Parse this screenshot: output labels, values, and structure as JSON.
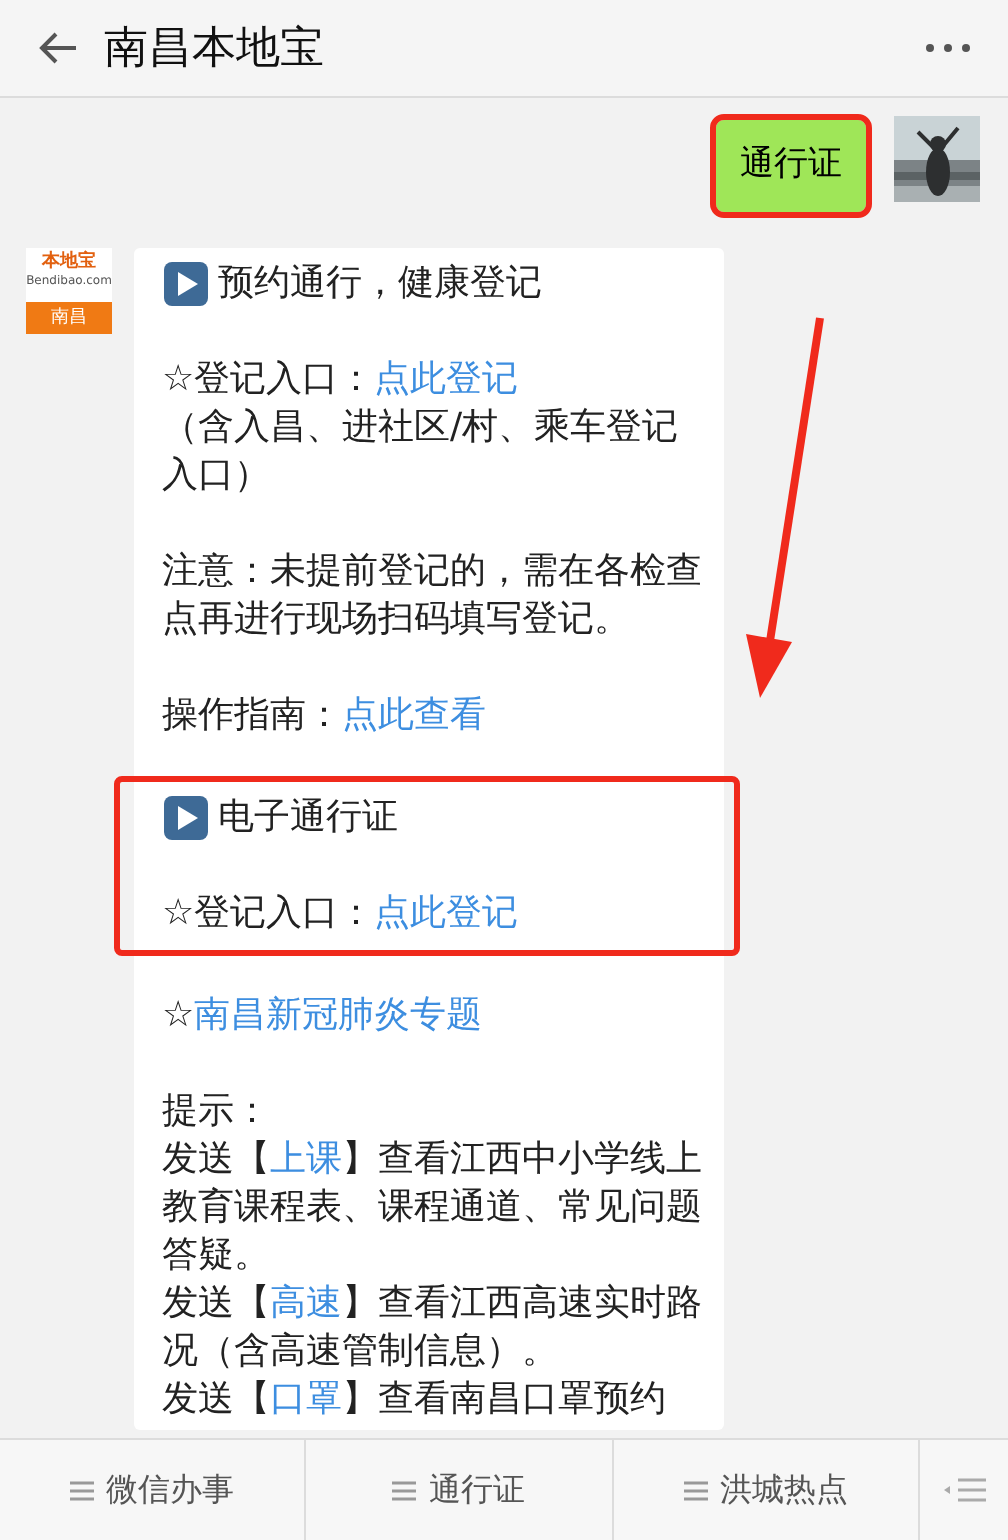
{
  "header": {
    "title": "南昌本地宝"
  },
  "user_message": {
    "text": "通行证",
    "highlighted": true
  },
  "bot": {
    "avatar_brand": "本地宝",
    "avatar_domain": "Bendibao.com",
    "avatar_city": "南昌"
  },
  "blocks": [
    {
      "highlighted": false,
      "lines": [
        {
          "kind": "heading",
          "text": "预约通行，健康登记"
        }
      ]
    },
    {
      "highlighted": false,
      "lines": [
        {
          "kind": "field",
          "label": "☆登记入口：",
          "link": "点此登记"
        },
        {
          "kind": "paragraph",
          "text": "（含入昌、进社区/村、乘车登记入口）"
        }
      ]
    },
    {
      "highlighted": false,
      "lines": [
        {
          "kind": "paragraph",
          "text": "注意：未提前登记的，需在各检查点再进行现场扫码填写登记。"
        }
      ]
    },
    {
      "highlighted": false,
      "lines": [
        {
          "kind": "field",
          "label": "操作指南：",
          "link": "点此查看"
        }
      ]
    },
    {
      "highlighted": true,
      "lines": [
        {
          "kind": "heading",
          "text": "电子通行证"
        },
        {
          "kind": "field",
          "label": "☆登记入口：",
          "link": "点此登记"
        }
      ]
    },
    {
      "highlighted": false,
      "lines": [
        {
          "kind": "field",
          "label": "☆",
          "link": "南昌新冠肺炎专题"
        }
      ]
    },
    {
      "highlighted": false,
      "lines": [
        {
          "kind": "paragraph",
          "text": "提示："
        },
        {
          "kind": "send",
          "before": "发送【",
          "keyword": "上课",
          "after": "】查看江西中小学线上教育课程表、课程通道、常见问题答疑。"
        },
        {
          "kind": "send",
          "before": "发送【",
          "keyword": "高速",
          "after": "】查看江西高速实时路况（含高速管制信息）。"
        },
        {
          "kind": "send",
          "before": "发送【",
          "keyword": "口罩",
          "after": "】查看南昌口罩预约"
        }
      ]
    }
  ],
  "menu": [
    {
      "label": "微信办事"
    },
    {
      "label": "通行证"
    },
    {
      "label": "洪城热点"
    }
  ]
}
